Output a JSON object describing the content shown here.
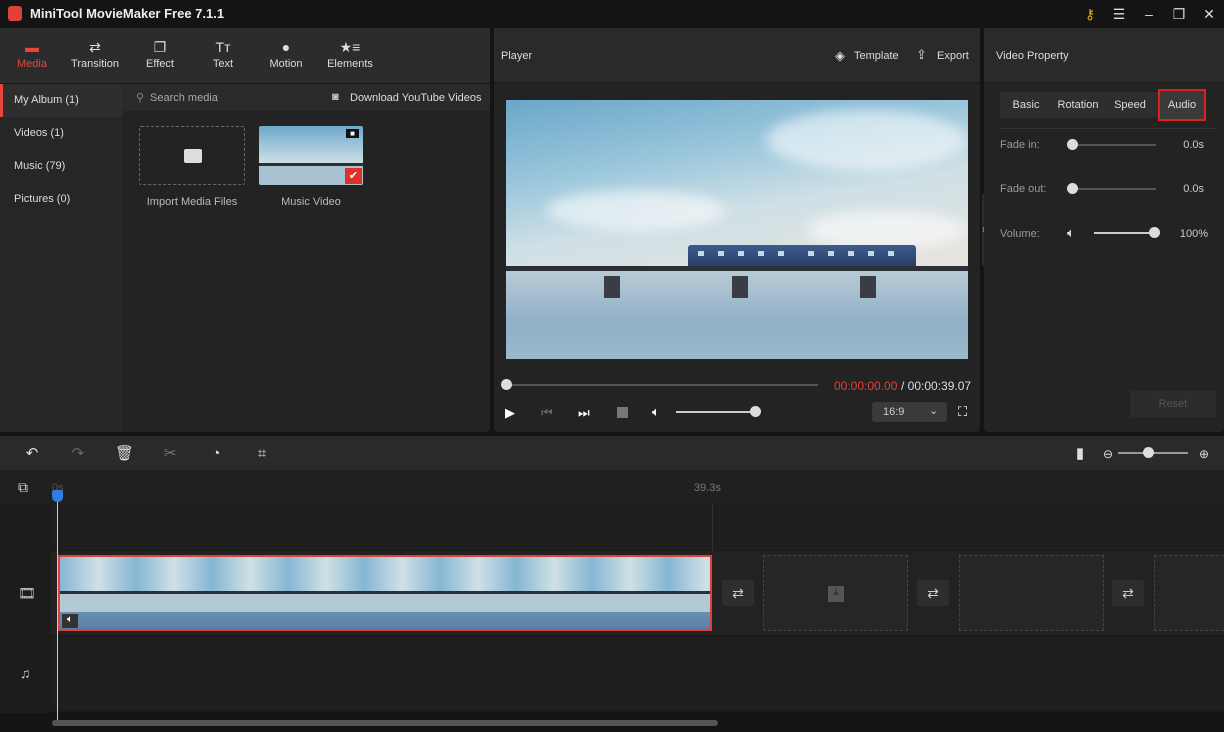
{
  "app": {
    "title": "MiniTool MovieMaker Free 7.1.1"
  },
  "toolbar": {
    "tabs": [
      {
        "label": "Media",
        "icon": "folder-icon"
      },
      {
        "label": "Transition",
        "icon": "swap-icon"
      },
      {
        "label": "Effect",
        "icon": "layers-icon"
      },
      {
        "label": "Text",
        "icon": "text-icon"
      },
      {
        "label": "Motion",
        "icon": "motion-icon"
      },
      {
        "label": "Elements",
        "icon": "star-list-icon"
      }
    ],
    "active": "Media"
  },
  "sidebar": {
    "items": [
      {
        "label": "My Album (1)"
      },
      {
        "label": "Videos (1)"
      },
      {
        "label": "Music (79)"
      },
      {
        "label": "Pictures (0)"
      }
    ]
  },
  "media": {
    "search_placeholder": "Search media",
    "download_label": "Download YouTube Videos",
    "items": [
      {
        "label": "Import Media Files"
      },
      {
        "label": "Music Video"
      }
    ]
  },
  "player": {
    "title": "Player",
    "template_label": "Template",
    "export_label": "Export",
    "current_time": "00:00:00.00",
    "total_time": "/ 00:00:39.07",
    "aspect": "16:9",
    "volume_percent": 100,
    "progress_percent": 0
  },
  "property": {
    "title": "Video Property",
    "tabs": [
      "Basic",
      "Rotation",
      "Speed",
      "Audio"
    ],
    "active_tab": "Audio",
    "fade_in_label": "Fade in:",
    "fade_in_value": "0.0s",
    "fade_out_label": "Fade out:",
    "fade_out_value": "0.0s",
    "volume_label": "Volume:",
    "volume_value": "100%",
    "reset_label": "Reset"
  },
  "timeline": {
    "start_label": "0s",
    "end_label": "39.3s"
  },
  "colors": {
    "accent": "#e8453c",
    "playhead": "#2f7de1",
    "background": "#232323"
  }
}
